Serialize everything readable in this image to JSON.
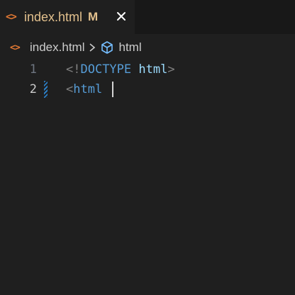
{
  "tab": {
    "icon": "<>",
    "label": "index.html",
    "modified": "M",
    "close_icon": "close-icon"
  },
  "breadcrumb": {
    "file_icon": "<>",
    "file": "index.html",
    "symbol": "html",
    "symbol_icon": "cube-icon"
  },
  "editor": {
    "lines": [
      {
        "number": "1",
        "open": "<!",
        "tag": "DOCTYPE",
        "space": " ",
        "attr": "html",
        "close": ">"
      },
      {
        "number": "2",
        "open": "<",
        "tag": "html",
        "trail": " "
      }
    ],
    "active_line": "2"
  },
  "colors": {
    "background": "#1f1f1f",
    "tab_label": "#e2c08d",
    "file_icon": "#e37933",
    "tag": "#569cd6",
    "attribute": "#9cdcfe",
    "punctuation": "#808080"
  }
}
